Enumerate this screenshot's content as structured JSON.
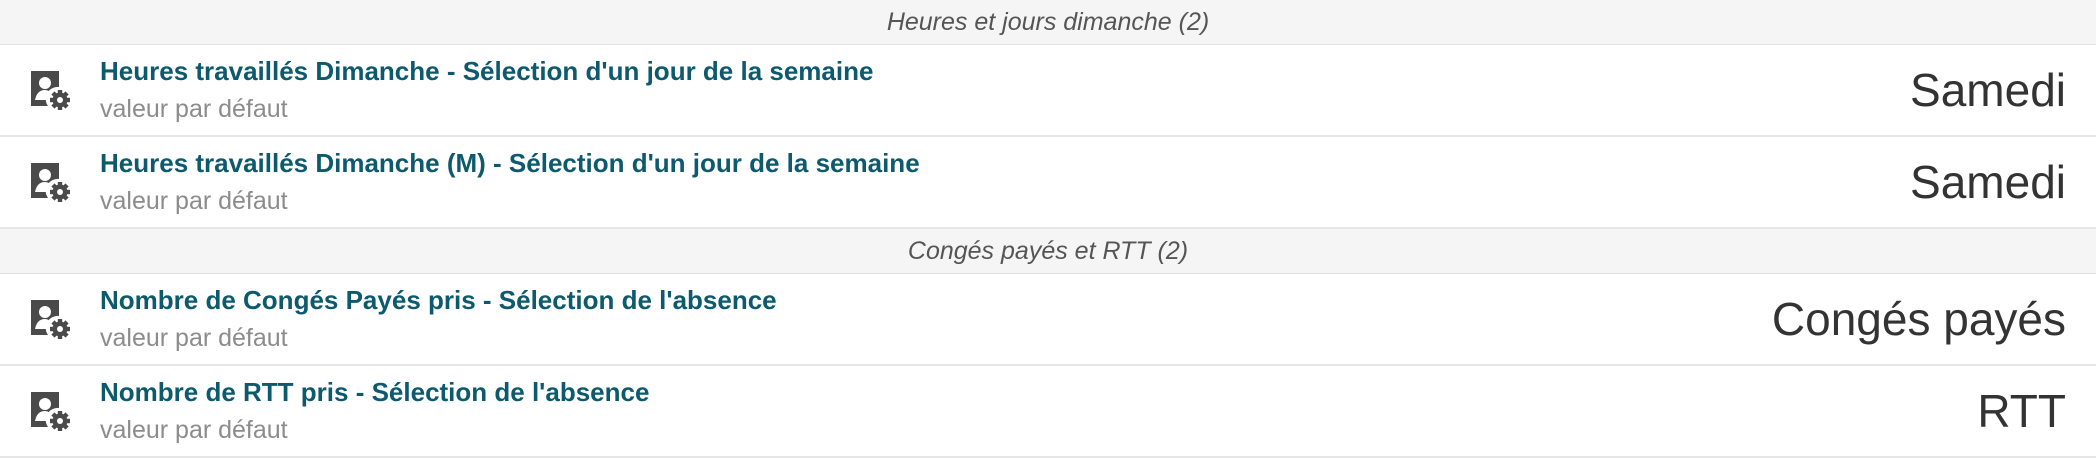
{
  "groups": [
    {
      "header": "Heures et jours dimanche (2)",
      "items": [
        {
          "title": "Heures travaillés Dimanche - Sélection d'un jour de la semaine",
          "subtitle": "valeur par défaut",
          "value": "Samedi",
          "icon": "user-settings-icon"
        },
        {
          "title": "Heures travaillés Dimanche (M) - Sélection d'un jour de la semaine",
          "subtitle": "valeur par défaut",
          "value": "Samedi",
          "icon": "user-settings-icon"
        }
      ]
    },
    {
      "header": "Congés payés et RTT (2)",
      "items": [
        {
          "title": "Nombre de Congés Payés pris - Sélection de l'absence",
          "subtitle": "valeur par défaut",
          "value": "Congés payés",
          "icon": "user-settings-icon"
        },
        {
          "title": "Nombre de RTT pris - Sélection de l'absence",
          "subtitle": "valeur par défaut",
          "value": "RTT",
          "icon": "user-settings-icon"
        }
      ]
    }
  ],
  "colors": {
    "title": "#0d5a6e",
    "subtitle": "#8c8c8c",
    "value": "#333333",
    "header_bg": "#f5f5f5",
    "icon": "#4a4a4a"
  }
}
